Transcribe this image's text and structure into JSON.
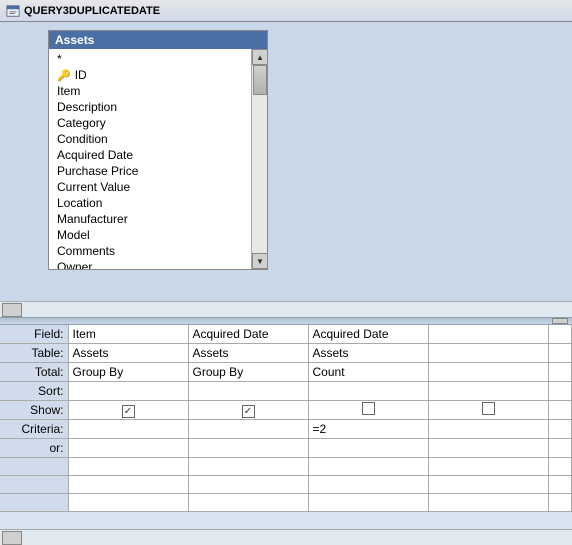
{
  "titleBar": {
    "icon": "query-icon",
    "title": "QUERY3DUPLICATEDATE"
  },
  "tableBox": {
    "header": "Assets",
    "fields": [
      {
        "name": "*",
        "type": "star"
      },
      {
        "name": "ID",
        "type": "key"
      },
      {
        "name": "Item",
        "type": "normal"
      },
      {
        "name": "Description",
        "type": "normal"
      },
      {
        "name": "Category",
        "type": "normal"
      },
      {
        "name": "Condition",
        "type": "normal"
      },
      {
        "name": "Acquired Date",
        "type": "normal"
      },
      {
        "name": "Purchase Price",
        "type": "normal"
      },
      {
        "name": "Current Value",
        "type": "normal"
      },
      {
        "name": "Location",
        "type": "normal"
      },
      {
        "name": "Manufacturer",
        "type": "normal"
      },
      {
        "name": "Model",
        "type": "normal"
      },
      {
        "name": "Comments",
        "type": "normal"
      },
      {
        "name": "Owner",
        "type": "normal"
      }
    ]
  },
  "qbeGrid": {
    "rowHeaders": [
      "Field:",
      "Table:",
      "Total:",
      "Sort:",
      "Show:",
      "Criteria:",
      "or:"
    ],
    "columns": [
      {
        "field": "Item",
        "table": "Assets",
        "total": "Group By",
        "sort": "",
        "show": true,
        "criteria": "",
        "or": ""
      },
      {
        "field": "Acquired Date",
        "table": "Assets",
        "total": "Group By",
        "sort": "",
        "show": true,
        "criteria": "",
        "or": ""
      },
      {
        "field": "Acquired Date",
        "table": "Assets",
        "total": "Count",
        "sort": "",
        "show": false,
        "criteria": "=2",
        "or": ""
      },
      {
        "field": "",
        "table": "",
        "total": "",
        "sort": "",
        "show": false,
        "criteria": "",
        "or": ""
      }
    ]
  }
}
